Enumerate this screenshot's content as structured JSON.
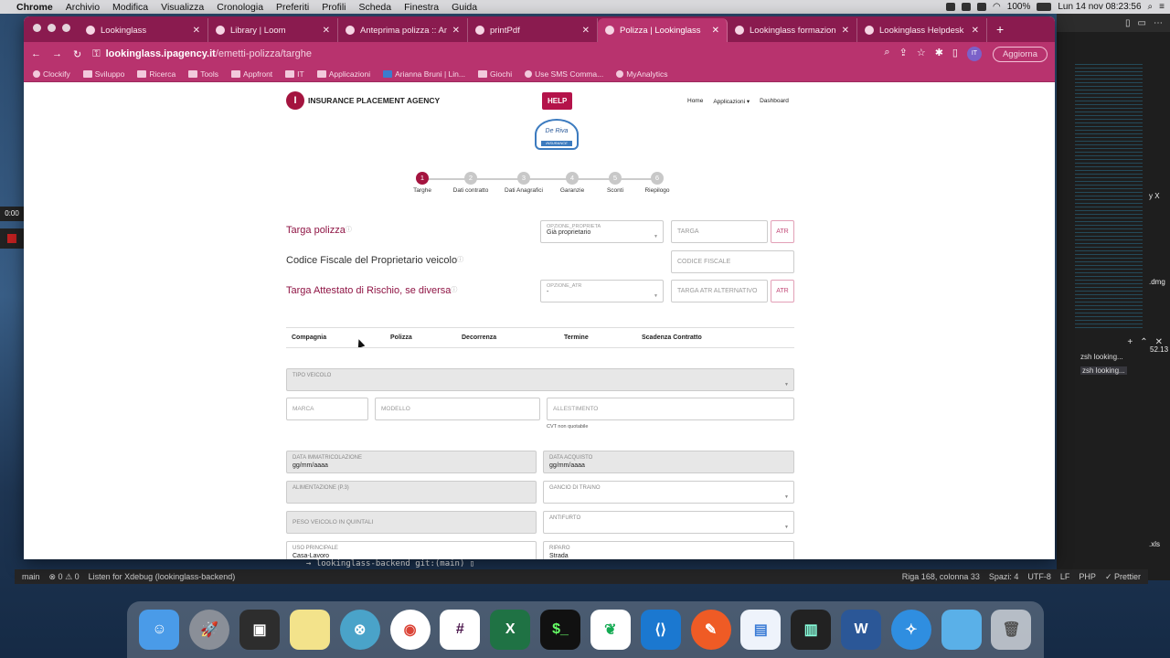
{
  "menubar": {
    "items": [
      "Chrome",
      "Archivio",
      "Modifica",
      "Visualizza",
      "Cronologia",
      "Preferiti",
      "Profili",
      "Scheda",
      "Finestra",
      "Guida"
    ],
    "battery": "100%",
    "datetime": "Lun 14 nov  08:23:56"
  },
  "tabs": [
    {
      "label": "Lookinglass",
      "active": false
    },
    {
      "label": "Library | Loom",
      "active": false
    },
    {
      "label": "Anteprima polizza :: Ammi",
      "active": false
    },
    {
      "label": "printPdf",
      "active": false
    },
    {
      "label": "Polizza | Lookinglass",
      "active": true
    },
    {
      "label": "Lookinglass formazione u",
      "active": false
    },
    {
      "label": "Lookinglass Helpdesk | Te",
      "active": false
    }
  ],
  "toolbar": {
    "url_host": "lookinglass.ipagency.it",
    "url_path": "/emetti-polizza/targhe",
    "profile": "IT",
    "update_label": "Aggiorna"
  },
  "bookmarks": [
    "Clockify",
    "Sviluppo",
    "Ricerca",
    "Tools",
    "Appfront",
    "IT",
    "Applicazioni",
    "Arianna Bruni | Lin...",
    "Giochi",
    "Use SMS Comma...",
    "MyAnalytics"
  ],
  "page": {
    "brand": "INSURANCE PLACEMENT AGENCY",
    "help_label": "HELP",
    "nav": [
      "Home",
      "Applicazioni ▾",
      "Dashboard"
    ],
    "brand_logo_text": "De Riva",
    "brand_logo_sub": "INSURANCE",
    "steps": [
      {
        "num": "1",
        "label": "Targhe",
        "active": true
      },
      {
        "num": "2",
        "label": "Dati contratto",
        "active": false
      },
      {
        "num": "3",
        "label": "Dati Anagrafici",
        "active": false
      },
      {
        "num": "4",
        "label": "Garanzie",
        "active": false
      },
      {
        "num": "5",
        "label": "Sconti",
        "active": false
      },
      {
        "num": "6",
        "label": "Riepilogo",
        "active": false
      }
    ],
    "q1": "Targa polizza",
    "q2": "Codice Fiscale del Proprietario veicolo",
    "q3": "Targa Attestato di Rischio, se diversa",
    "info_icon": "ⓘ",
    "opzione_proprieta": {
      "label": "OPZIONE_PROPRIETA",
      "value": "Già proprietario"
    },
    "targa_placeholder": "TARGA",
    "atr_label": "ATR",
    "cf_placeholder": "CODICE FISCALE",
    "opzione_atr": {
      "label": "OPZIONE_ATR",
      "value": "-"
    },
    "targa_atr_placeholder": "TARGA ATR ALTERNATIVO",
    "columns": [
      "Compagnia",
      "Polizza",
      "Decorrenza",
      "Termine",
      "Scadenza Contratto"
    ],
    "tipo_veicolo": "TIPO VEICOLO",
    "marca": "MARCA",
    "modello": "MODELLO",
    "allestimento": "ALLESTIMENTO",
    "cvt_note": "CVT non quotabile",
    "data_immatricolazione": {
      "label": "DATA IMMATRICOLAZIONE",
      "value": "gg/mm/aaaa"
    },
    "data_acquisto": {
      "label": "DATA ACQUISTO",
      "value": "gg/mm/aaaa"
    },
    "alimentazione": "ALIMENTAZIONE (P.3)",
    "gancio": "GANCIO DI TRAINO",
    "peso": "PESO VEICOLO IN QUINTALI",
    "antifurto": "ANTIFURTO",
    "uso": {
      "label": "USO PRINCIPALE",
      "value": "Casa-Lavoro"
    },
    "riparo": {
      "label": "RIPARO",
      "value": "Strada"
    }
  },
  "overlay": {
    "timer": "0:00"
  },
  "editor": {
    "terminal_prompt": "→  lookinglass-backend git:(main) ▯",
    "terminal_tabs": [
      "zsh  looking...",
      "zsh  looking..."
    ],
    "status_left": [
      "main",
      "⊗ 0 ⚠ 0",
      "Listen for Xdebug (lookinglass-backend)"
    ],
    "status_right": [
      "Riga 168, colonna 33",
      "Spazi: 4",
      "UTF-8",
      "LF",
      "PHP",
      "✓ Prettier"
    ],
    "side_labels": [
      "y X",
      ".dmg",
      "52.13",
      ".xls"
    ]
  },
  "dock": [
    "Finder",
    "Launchpad",
    "Photo Booth",
    "Notes",
    "Network",
    "Chrome",
    "Slack",
    "Excel",
    "Terminal",
    "MongoDB",
    "VS Code",
    "Postman",
    "Preview",
    "Monitor",
    "Word",
    "Safari",
    "Folder",
    "Trash"
  ]
}
